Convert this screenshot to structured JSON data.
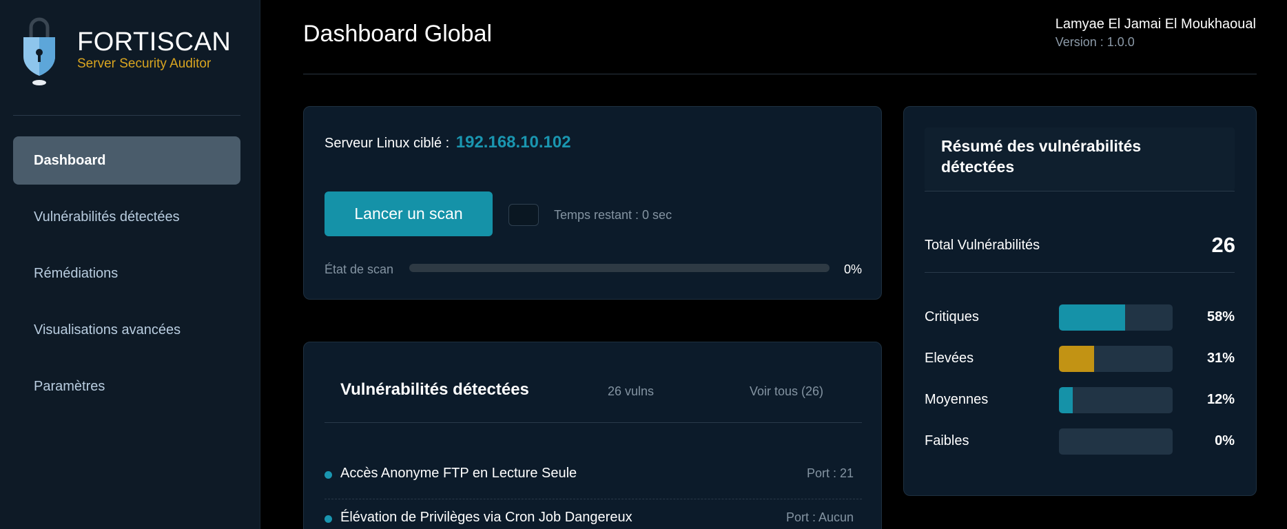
{
  "brand": {
    "name": "FORTISCAN",
    "subtitle": "Server Security Auditor",
    "accent_color": "#d9a520"
  },
  "sidebar": {
    "items": [
      {
        "label": "Dashboard",
        "active": true
      },
      {
        "label": "Vulnérabilités détectées",
        "active": false
      },
      {
        "label": "Rémédiations",
        "active": false
      },
      {
        "label": "Visualisations avancées",
        "active": false
      },
      {
        "label": "Paramètres",
        "active": false
      }
    ]
  },
  "header": {
    "title": "Dashboard Global",
    "user_name": "Lamyae El Jamai El Moukhaoual",
    "version": "Version : 1.0.0"
  },
  "scan": {
    "target_label": "Serveur Linux ciblé :",
    "target_ip": "192.168.10.102",
    "button_label": "Lancer un scan",
    "time_left": "Temps restant : 0 sec",
    "state_label": "État de scan",
    "progress_pct": "0%",
    "progress_value": 0,
    "accent_color": "#1592a8"
  },
  "vulns": {
    "title": "Vulnérabilités détectées",
    "count_label": "26 vulns",
    "see_all": "Voir tous (26)",
    "items": [
      {
        "name": "Accès Anonyme FTP en Lecture Seule",
        "port": "Port : 21"
      },
      {
        "name": "Élévation de Privilèges via Cron Job Dangereux",
        "port": "Port : Aucun"
      }
    ]
  },
  "summary": {
    "title": "Résumé des vulnérabilités détectées",
    "total_label": "Total Vulnérabilités",
    "total_value": "26",
    "severities": [
      {
        "label": "Critiques",
        "pct_label": "58%",
        "value": 58,
        "color": "#1592a8"
      },
      {
        "label": "Elevées",
        "pct_label": "31%",
        "value": 31,
        "color": "#c29314"
      },
      {
        "label": "Moyennes",
        "pct_label": "12%",
        "value": 12,
        "color": "#1592a8"
      },
      {
        "label": "Faibles",
        "pct_label": "0%",
        "value": 0,
        "color": "#1592a8"
      }
    ]
  }
}
